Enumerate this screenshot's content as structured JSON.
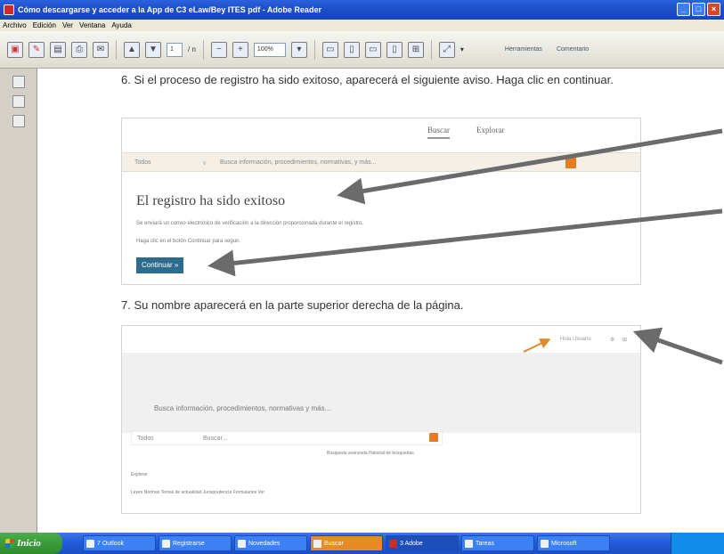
{
  "window": {
    "title": "Cómo descargarse y acceder a la App de C3 eLaw/Bey ITES pdf - Adobe Reader",
    "min_label": "_",
    "max_label": "□",
    "close_label": "×"
  },
  "menu": [
    "Archivo",
    "Edición",
    "Ver",
    "Ventana",
    "Ayuda"
  ],
  "toolbar": {
    "page_current": "1",
    "page_total": "/ n",
    "zoom": "100%",
    "link_fill_sign": "Herramientas",
    "link_comment": "Comentario"
  },
  "icons": {
    "toolbar": [
      "open-icon",
      "create-icon",
      "save-icon",
      "print-icon",
      "email-icon",
      "prev-page-icon",
      "next-page-icon",
      "zoom-out-icon",
      "zoom-in-icon",
      "fit-page-icon",
      "fit-width-icon",
      "single-page-icon",
      "scroll-icon",
      "two-up-icon",
      "fullscreen-icon"
    ],
    "nav": [
      "pages-icon",
      "attachment-icon",
      "signature-icon"
    ]
  },
  "doc": {
    "step6": "6. Si el proceso de registro ha sido exitoso, aparecerá el siguiente aviso. Haga clic en continuar.",
    "step7": "7. Su nombre aparecerá en la parte superior derecha de la página."
  },
  "shot1": {
    "tab_search": "Buscar",
    "tab_explore": "Explorar",
    "select_label": "Todos",
    "search_placeholder": "Busca información, procedimientos, normativas, y más...",
    "headline": "El registro ha sido exitoso",
    "info_line": "Se enviará un correo electrónico de verificación a la dirección proporcionada durante el registro.",
    "click_line": "Haga clic en el botón Continuar para seguir.",
    "button": "Continuar »"
  },
  "shot2": {
    "user_name": "Hola Usuario",
    "search_prompt": "Busca información, procedimientos, normativas y más...",
    "select_label": "Todos",
    "search_placeholder": "Buscar...",
    "links": "Búsqueda avanzada   Historial de búsquedas",
    "section_label": "Explorar",
    "topics": "Leyes   Normas   Temas de actualidad   Jurisprudencia   Formularios   Ver"
  },
  "taskbar": {
    "start": "Inicio",
    "items": [
      "7 Outlook",
      "Registrarse",
      "Novedades",
      "Buscar",
      "3 Adobe",
      "Tareas",
      "Microsoft"
    ]
  },
  "colors": {
    "titlebar": "#1d4fc9",
    "arrow": "#6b6b6b",
    "accent_orange": "#e57c22",
    "button_blue": "#2e6c8e"
  }
}
